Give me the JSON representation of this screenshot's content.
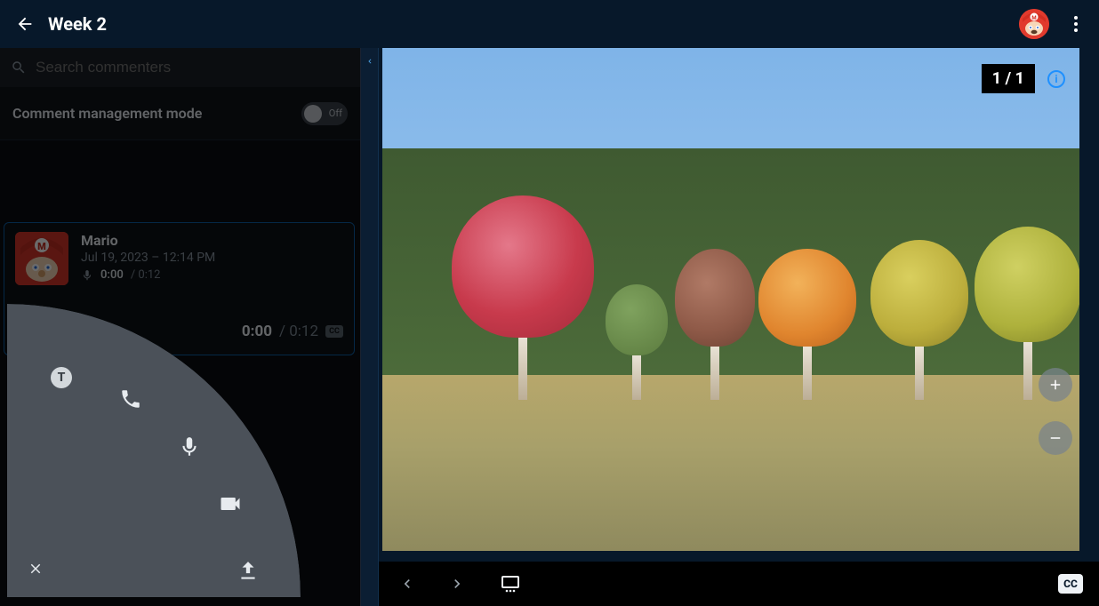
{
  "header": {
    "title": "Week 2"
  },
  "sidebar": {
    "search_placeholder": "Search commenters",
    "mgmt_label": "Comment management mode",
    "toggle_label": "Off",
    "comment": {
      "author": "Mario",
      "timestamp": "Jul 19, 2023 – 12:14 PM",
      "clip_current": "0:00",
      "clip_total": "0:12",
      "player_current": "0:00",
      "player_total": "0:12",
      "cc_badge": "CC"
    }
  },
  "radial": {
    "text_label": "T"
  },
  "viewer": {
    "page_current": "1",
    "page_sep": " / ",
    "page_total": "1",
    "cc_label": "CC"
  },
  "icons": {
    "info": "i"
  }
}
